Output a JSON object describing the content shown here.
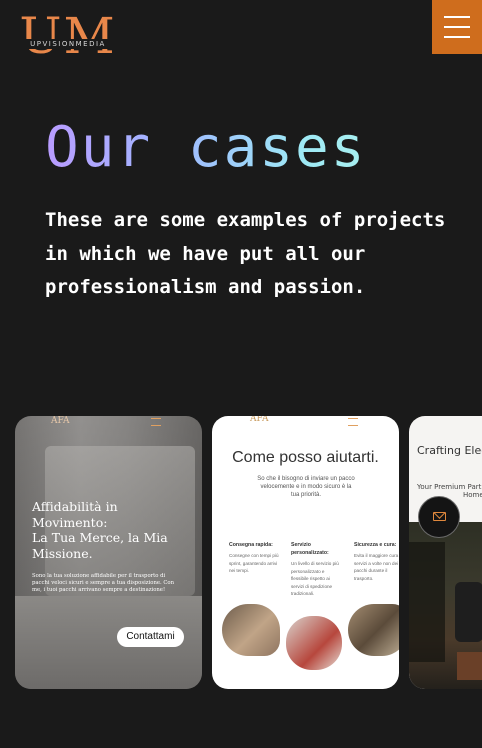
{
  "logo": {
    "letters": "UM",
    "tagline": "UPVISIONMEDIA"
  },
  "main": {
    "title": "Our cases",
    "subtitle": "These are some examples of projects in which we have put all our professionalism and passion."
  },
  "cards": [
    {
      "mini_logo": "AFA",
      "heading_line1": "Affidabilità in Movimento:",
      "heading_line2": "La Tua Merce, la Mia Missione.",
      "body": "Sono la tua soluzione affidabile per il trasporto di pacchi veloci sicuri e sempre a tua disposizione. Con me, i tuoi pacchi arrivano sempre a destinazione!",
      "cta": "Contattami"
    },
    {
      "mini_logo": "AFA",
      "heading": "Come posso aiutarti.",
      "lead": "So che il bisogno di inviare un pacco velocemente e in modo sicuro è la tua priorità.",
      "columns": [
        {
          "title": "Consegna rapida:",
          "body": "Consegne con tempi più sprint, garantendo arrivi nei tempi."
        },
        {
          "title": "Servizio personalizzato:",
          "body": "Un livello di servizio più personalizzato e flessibile rispetto ai servizi di spedizione tradizionali."
        },
        {
          "title": "Sicurezza e cura:",
          "body": "Evita il maggiore cura dei servizi a volte non dei pacchi durante il trasporto."
        }
      ]
    },
    {
      "heading": "Crafting Elega",
      "sub_line1": "Your Premium Partner",
      "sub_line2": "Home"
    }
  ],
  "icons": {
    "menu": "hamburger-icon",
    "mail": "envelope-icon"
  },
  "colors": {
    "accent": "#cf6d1d",
    "background": "#1a1a1a",
    "title_gradient_start": "#b99cff",
    "title_gradient_end": "#a8f0f0"
  }
}
